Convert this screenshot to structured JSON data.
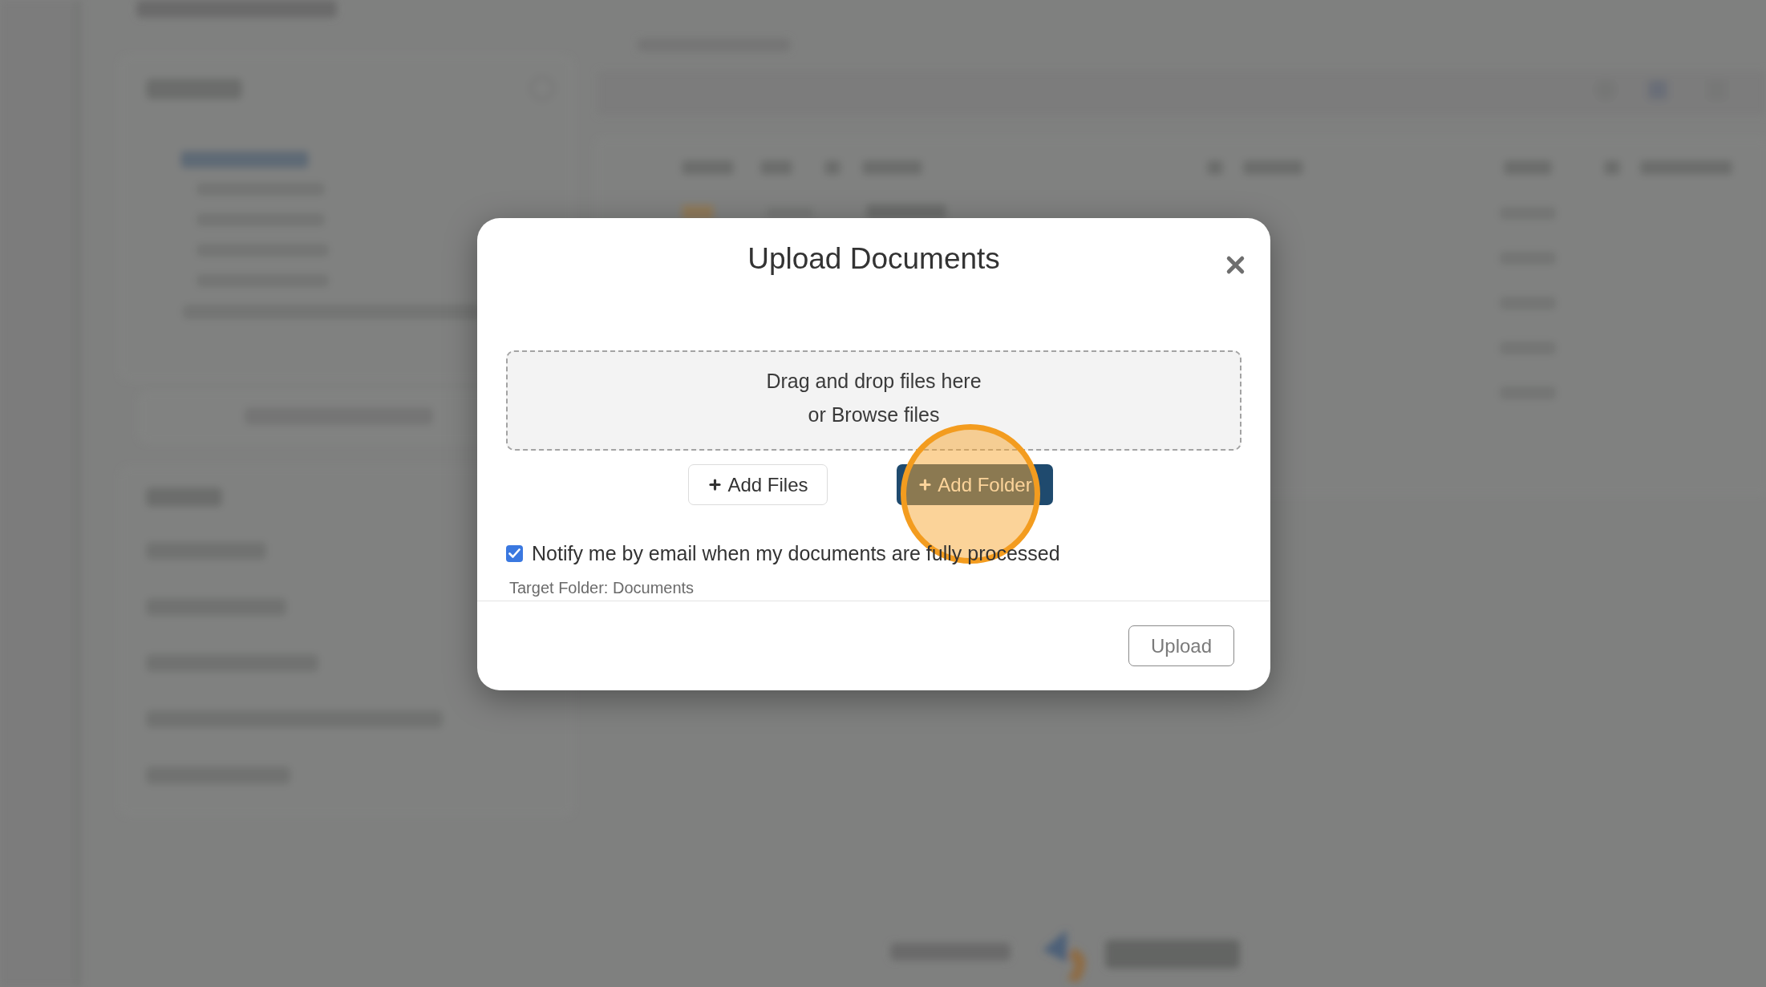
{
  "dialog": {
    "title": "Upload Documents",
    "drop_zone": {
      "lines": [
        "Drag and drop files here",
        "or Browse files"
      ]
    },
    "buttons": [
      {
        "kind": "outline",
        "label": "Add Files"
      },
      {
        "kind": "primary",
        "label": "Add Folder"
      }
    ],
    "notify": {
      "label": "Notify me by email when my documents are fully processed",
      "checked": true
    },
    "target_folder": "Target Folder: Documents",
    "footer": {
      "upload": {
        "label": "Upload",
        "disabled": true
      }
    }
  }
}
